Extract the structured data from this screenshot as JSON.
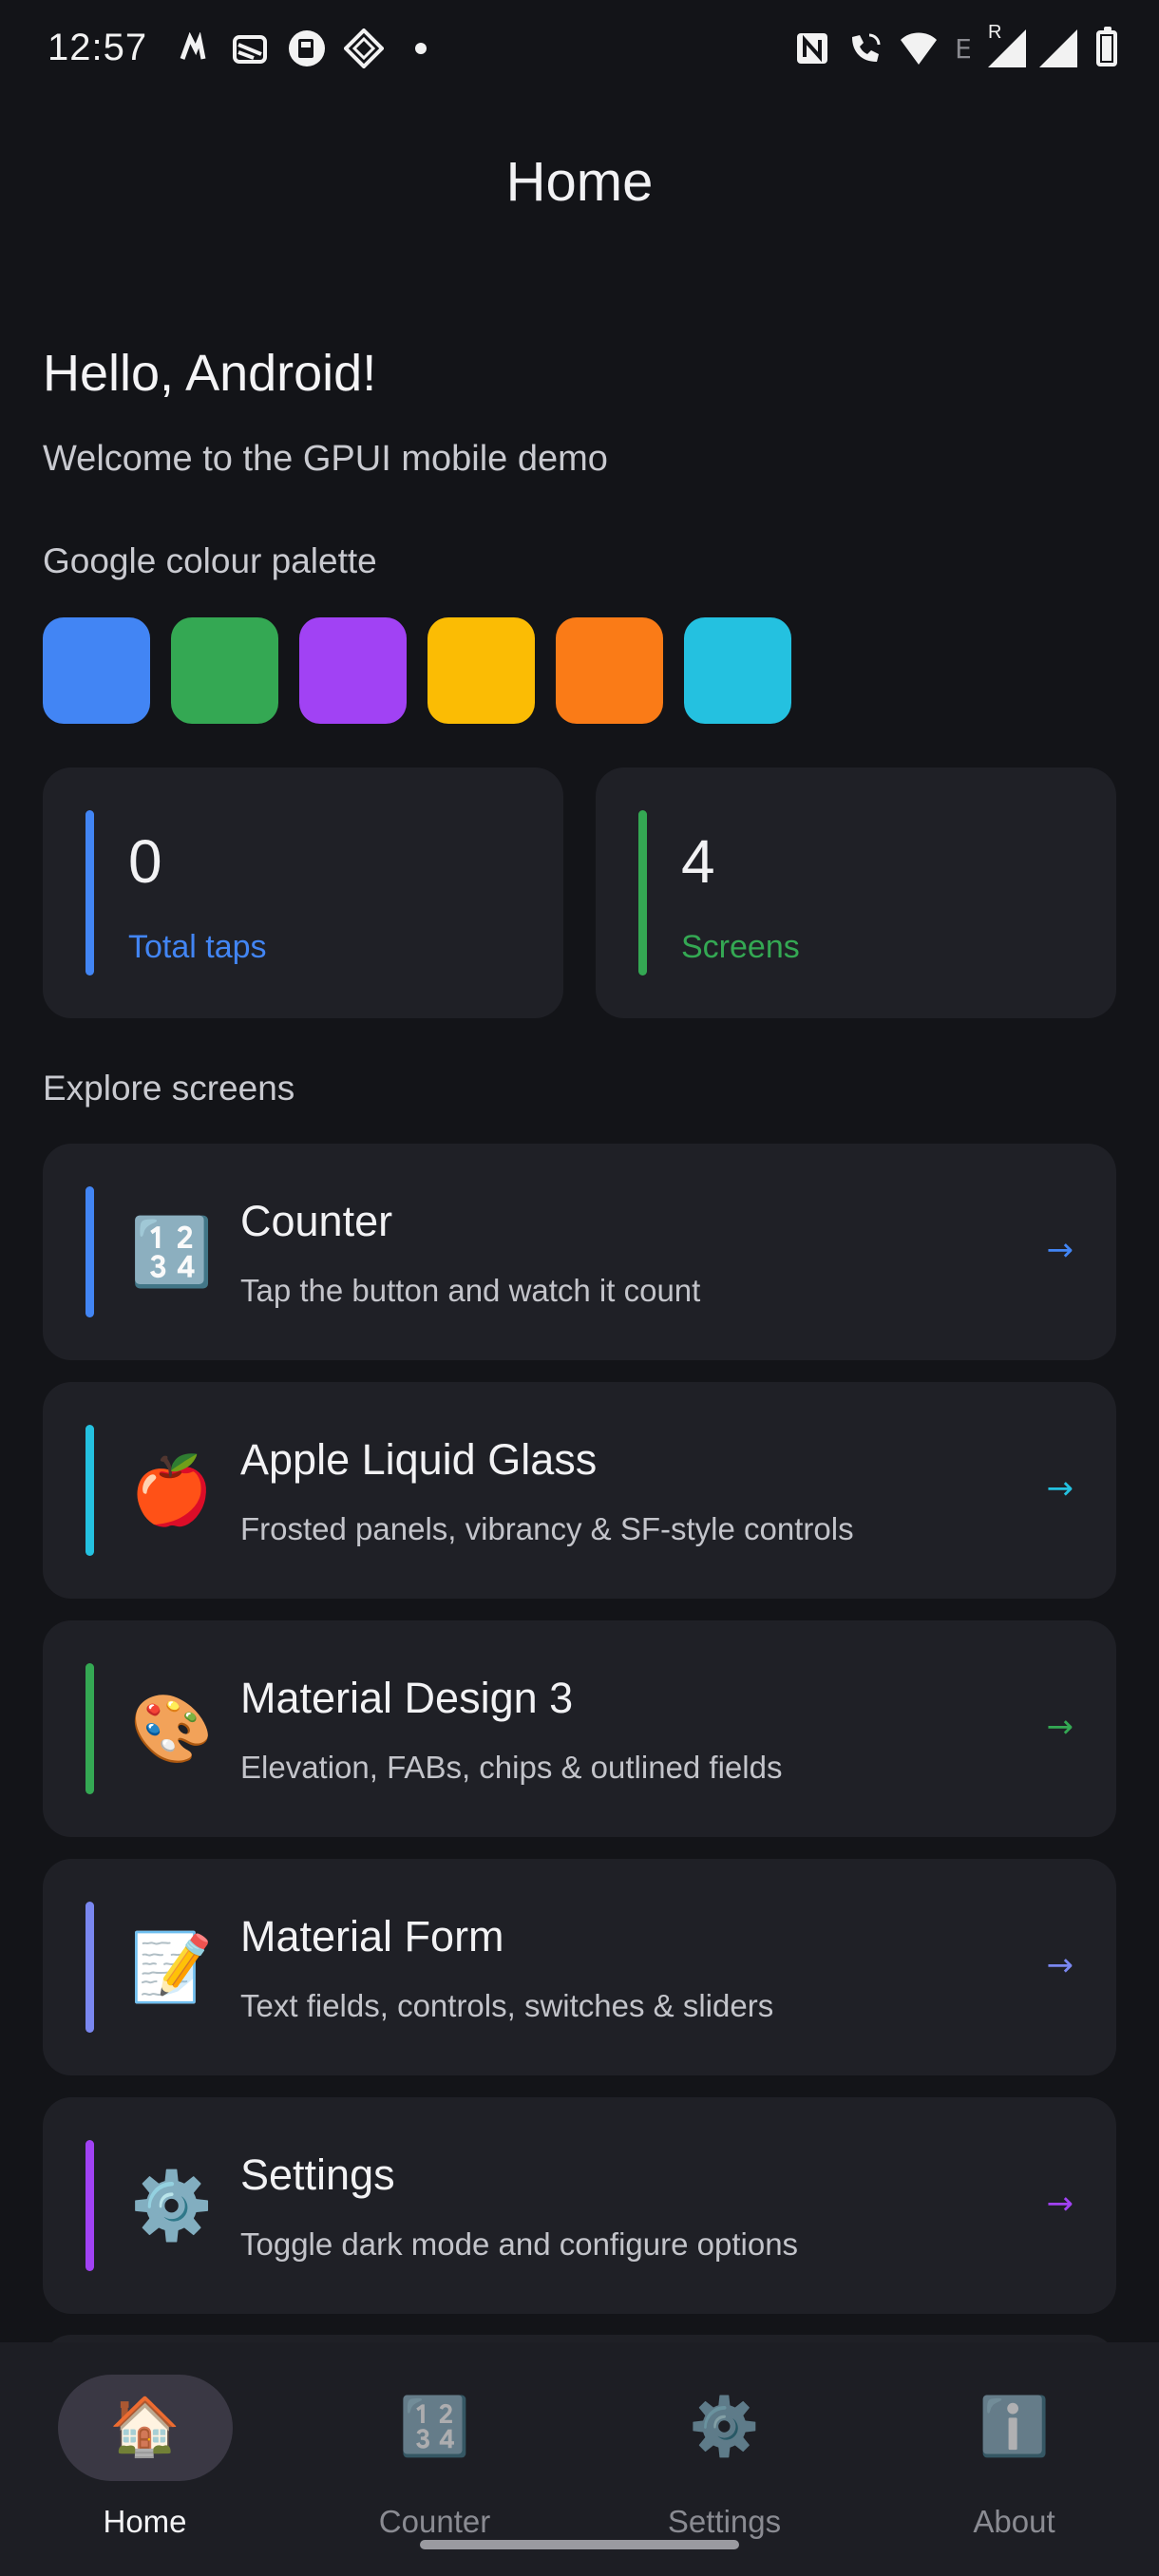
{
  "status_bar": {
    "time": "12:57",
    "left_icons": [
      "notification-n-icon",
      "layers-icon",
      "coffee-icon",
      "diamond-grid-icon",
      "dot-icon"
    ],
    "right_icons": [
      "nfc-icon",
      "wifi-calling-icon",
      "wifi-icon",
      "signal-icon",
      "signal-icon",
      "battery-icon"
    ],
    "network_letters": "E",
    "roaming_letter": "R"
  },
  "app_bar": {
    "title": "Home"
  },
  "greeting": "Hello, Android!",
  "subtitle": "Welcome to the GPUI mobile demo",
  "palette": {
    "label": "Google colour palette",
    "colors": [
      "#4285f4",
      "#34a853",
      "#a142f4",
      "#fbbc04",
      "#fa7b17",
      "#24c1e0"
    ]
  },
  "stats": [
    {
      "value": "0",
      "label": "Total taps",
      "color": "#4285f4"
    },
    {
      "value": "4",
      "label": "Screens",
      "color": "#34a853"
    }
  ],
  "explore": {
    "label": "Explore screens",
    "items": [
      {
        "emoji": "🔢",
        "icon_name": "counter-icon",
        "title": "Counter",
        "desc": "Tap the button and watch it count",
        "color": "#4285f4",
        "arrow": "→"
      },
      {
        "emoji": "🍎",
        "icon_name": "apple-icon",
        "title": "Apple Liquid Glass",
        "desc": "Frosted panels, vibrancy & SF-style controls",
        "color": "#24c1e0",
        "arrow": "→"
      },
      {
        "emoji": "🎨",
        "icon_name": "palette-icon",
        "title": "Material Design 3",
        "desc": "Elevation, FABs, chips & outlined fields",
        "color": "#34a853",
        "arrow": "→"
      },
      {
        "emoji": "📝",
        "icon_name": "memo-icon",
        "title": "Material Form",
        "desc": "Text fields, controls, switches & sliders",
        "color": "#7a87f0",
        "arrow": "→"
      },
      {
        "emoji": "⚙️",
        "icon_name": "gear-icon",
        "title": "Settings",
        "desc": "Toggle dark mode and configure options",
        "color": "#a142f4",
        "arrow": "→"
      }
    ]
  },
  "bottom_nav": {
    "tabs": [
      {
        "icon": "🏠",
        "icon_name": "home-icon",
        "label": "Home",
        "active": true
      },
      {
        "icon": "🔢",
        "icon_name": "counter-icon",
        "label": "Counter",
        "active": false
      },
      {
        "icon": "⚙️",
        "icon_name": "gear-icon",
        "label": "Settings",
        "active": false
      },
      {
        "icon": "ℹ️",
        "icon_name": "info-icon",
        "label": "About",
        "active": false
      }
    ]
  }
}
